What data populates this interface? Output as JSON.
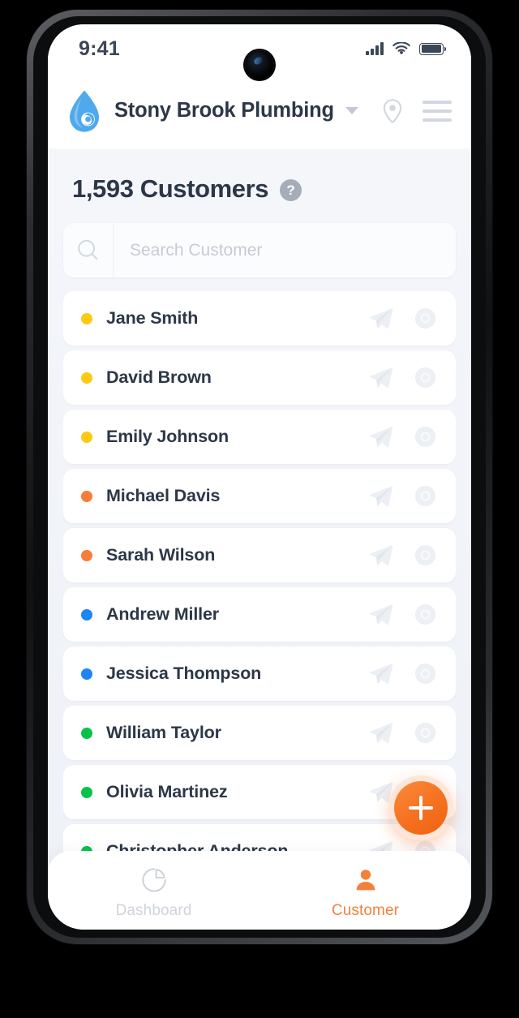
{
  "status_bar": {
    "time": "9:41",
    "icons": [
      "signal-bars-icon",
      "wifi-icon",
      "battery-icon"
    ]
  },
  "header": {
    "logo_icon": "water-droplet-logo",
    "company_name": "Stony Brook Plumbing",
    "dropdown_icon": "chevron-down-icon",
    "location_icon": "location-pin-icon",
    "menu_icon": "hamburger-menu-icon",
    "brand_color": "#46a6ee"
  },
  "main": {
    "title": "1,593 Customers",
    "help_icon_label": "?",
    "search": {
      "placeholder": "Search Customer",
      "value": "",
      "icon": "search-icon"
    },
    "row_icons": {
      "send": "send-paper-plane-icon",
      "view": "eye-view-icon"
    },
    "status_colors": {
      "yellow": "#fdc913",
      "orange": "#f87c3a",
      "blue": "#1f85f5",
      "green": "#0ac14a"
    },
    "customers": [
      {
        "name": "Jane Smith",
        "status": "yellow"
      },
      {
        "name": "David Brown",
        "status": "yellow"
      },
      {
        "name": "Emily Johnson",
        "status": "yellow"
      },
      {
        "name": "Michael Davis",
        "status": "orange"
      },
      {
        "name": "Sarah Wilson",
        "status": "orange"
      },
      {
        "name": "Andrew Miller",
        "status": "blue"
      },
      {
        "name": "Jessica Thompson",
        "status": "blue"
      },
      {
        "name": "William Taylor",
        "status": "green"
      },
      {
        "name": "Olivia Martinez",
        "status": "green"
      },
      {
        "name": "Christopher Anderson",
        "status": "green"
      }
    ]
  },
  "fab": {
    "label": "+",
    "icon": "plus-icon",
    "color": "#f5701f"
  },
  "bottom_nav": {
    "active": "Customer",
    "items": [
      {
        "label": "Dashboard",
        "icon": "pie-chart-icon",
        "active": false
      },
      {
        "label": "Customer",
        "icon": "person-icon",
        "active": true
      }
    ],
    "active_color": "#f5803c",
    "inactive_color": "#cfd4dc"
  }
}
